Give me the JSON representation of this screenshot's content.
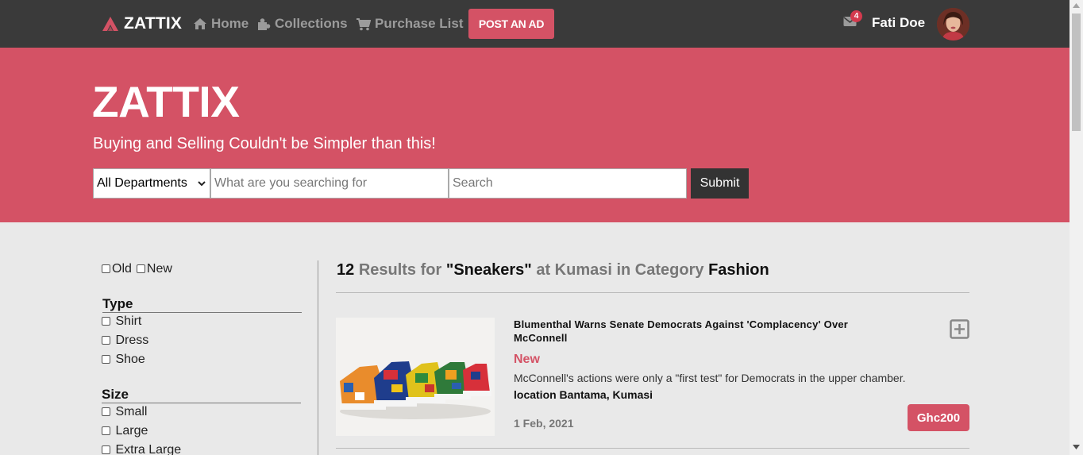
{
  "brand": {
    "name": "ZATTIX"
  },
  "nav": {
    "home": "Home",
    "collections": "Collections",
    "purchase_list": "Purchase List",
    "post_ad": "POST AN AD",
    "mail_count": "4",
    "username": "Fati Doe"
  },
  "hero": {
    "title": "ZATTIX",
    "subtitle": "Buying and Selling Couldn't be Simpler than this!",
    "department": "All Departments",
    "search_placeholder": "What are you searching for",
    "location_placeholder": "Search",
    "submit": "Submit"
  },
  "filters": {
    "condition": [
      "Old",
      "New"
    ],
    "type": {
      "title": "Type",
      "options": [
        "Shirt",
        "Dress",
        "Shoe"
      ]
    },
    "size": {
      "title": "Size",
      "options": [
        "Small",
        "Large",
        "Extra Large"
      ]
    }
  },
  "results": {
    "count": "12",
    "results_for": "Results for",
    "query": "\"Sneakers\"",
    "at_location": "at Kumasi in Category",
    "category": "Fashion"
  },
  "items": [
    {
      "title": "Blumenthal Warns Senate Democrats Against 'Complacency' Over McConnell",
      "condition": "New",
      "description": "McConnell's actions were only a \"first test\" for Democrats in the upper chamber.",
      "location": "location Bantama, Kumasi",
      "date": "1 Feb, 2021",
      "price": "Ghc200"
    }
  ],
  "colors": {
    "accent": "#d45265",
    "navbar": "#3a3a3a",
    "background": "#e9e9e9"
  },
  "icons": [
    "brand-logo-icon",
    "home-icon",
    "puzzle-icon",
    "cart-icon",
    "mail-icon",
    "chevron-down-icon",
    "plus-square-icon"
  ]
}
